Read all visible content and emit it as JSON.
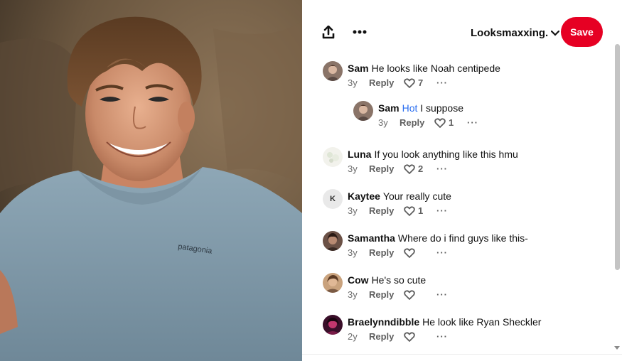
{
  "toolbar": {
    "board_name": "Looksmaxxing.",
    "save_label": "Save",
    "icons": [
      "share-icon",
      "more-icon",
      "chevron-down-icon"
    ]
  },
  "photo": {
    "shirt_text": "patagonia"
  },
  "comments": [
    {
      "name": "Sam",
      "mention": "",
      "text": "He looks like Noah centipede",
      "age": "3y",
      "reply": "Reply",
      "likes": "7",
      "avatar": "photo"
    },
    {
      "name": "Sam",
      "mention": "Hot",
      "text": " I suppose",
      "age": "3y",
      "reply": "Reply",
      "likes": "1",
      "avatar": "photo"
    },
    {
      "name": "Luna",
      "mention": "",
      "text": "If you look anything like this hmu",
      "age": "3y",
      "reply": "Reply",
      "likes": "2",
      "avatar": "photo"
    },
    {
      "name": "Kaytee",
      "mention": "",
      "text": "Your really cute",
      "age": "3y",
      "reply": "Reply",
      "likes": "1",
      "avatar": "K"
    },
    {
      "name": "Samantha",
      "mention": "",
      "text": "Where do i find guys like this-",
      "age": "3y",
      "reply": "Reply",
      "likes": "",
      "avatar": "photo"
    },
    {
      "name": "Cow",
      "mention": "",
      "text": "He's so cute",
      "age": "3y",
      "reply": "Reply",
      "likes": "",
      "avatar": "photo"
    },
    {
      "name": "Braelynndibble",
      "mention": "",
      "text": "He look like Ryan Sheckler",
      "age": "2y",
      "reply": "Reply",
      "likes": "",
      "avatar": "photo"
    }
  ],
  "colors": {
    "save": "#e60023",
    "mention": "#2b6ff0",
    "meta": "#6e6e6e"
  }
}
